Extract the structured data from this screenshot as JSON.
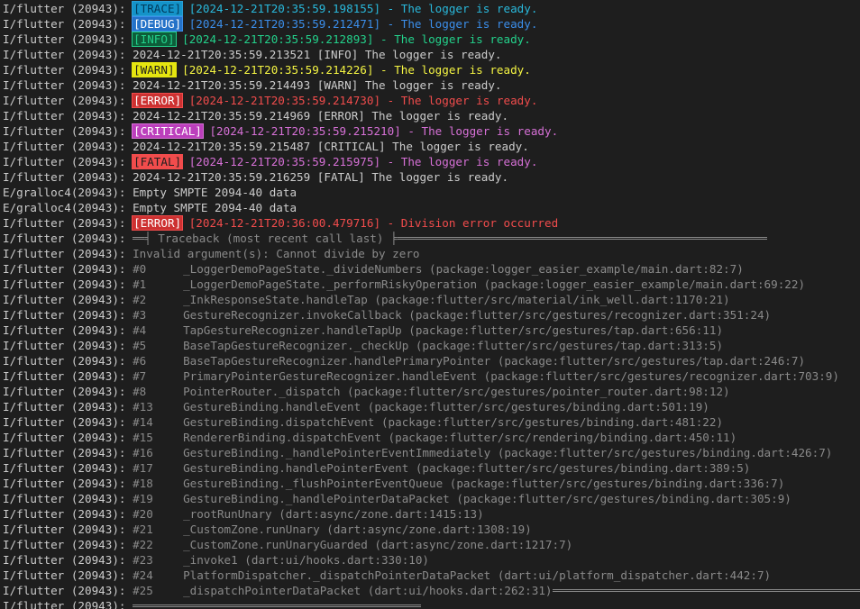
{
  "prefix_flutter": "I/flutter (20943): ",
  "prefix_gralloc": "E/gralloc4(20943): ",
  "intro_lines": [
    {
      "badge": "[TRACE]",
      "level": "trace",
      "text": " [2024-12-21T20:35:59.198155] - The logger is ready."
    },
    {
      "badge": "[DEBUG]",
      "level": "debug",
      "text": " [2024-12-21T20:35:59.212471] - The logger is ready."
    },
    {
      "badge": "[INFO]",
      "level": "info",
      "text": " [2024-12-21T20:35:59.212893] - The logger is ready."
    },
    {
      "plain": "2024-12-21T20:35:59.213521 [INFO] The logger is ready."
    },
    {
      "badge": "[WARN]",
      "level": "warn",
      "text": " [2024-12-21T20:35:59.214226] - The logger is ready."
    },
    {
      "plain": "2024-12-21T20:35:59.214493 [WARN] The logger is ready."
    },
    {
      "badge": "[ERROR]",
      "level": "error",
      "text": " [2024-12-21T20:35:59.214730] - The logger is ready."
    },
    {
      "plain": "2024-12-21T20:35:59.214969 [ERROR] The logger is ready."
    },
    {
      "badge": "[CRITICAL]",
      "level": "critical",
      "text": " [2024-12-21T20:35:59.215210] - The logger is ready."
    },
    {
      "plain": "2024-12-21T20:35:59.215487 [CRITICAL] The logger is ready."
    },
    {
      "badge": "[FATAL]",
      "level": "fatal",
      "text": " [2024-12-21T20:35:59.215975] - The logger is ready."
    },
    {
      "plain": "2024-12-21T20:35:59.216259 [FATAL] The logger is ready."
    },
    {
      "gralloc": "Empty SMPTE 2094-40 data"
    },
    {
      "gralloc": "Empty SMPTE 2094-40 data"
    },
    {
      "badge": "[ERROR]",
      "level": "error",
      "text": " [2024-12-21T20:36:00.479716] - Division error occurred"
    }
  ],
  "traceback_title": " Traceback (most recent call last) ",
  "error_message": "Invalid argument(s): Cannot divide by zero",
  "frames": [
    {
      "num": "#0",
      "frame": "_LoggerDemoPageState._divideNumbers (package:logger_easier_example/main.dart:82:7)"
    },
    {
      "num": "#1",
      "frame": "_LoggerDemoPageState._performRiskyOperation (package:logger_easier_example/main.dart:69:22)"
    },
    {
      "num": "#2",
      "frame": "_InkResponseState.handleTap (package:flutter/src/material/ink_well.dart:1170:21)"
    },
    {
      "num": "#3",
      "frame": "GestureRecognizer.invokeCallback (package:flutter/src/gestures/recognizer.dart:351:24)"
    },
    {
      "num": "#4",
      "frame": "TapGestureRecognizer.handleTapUp (package:flutter/src/gestures/tap.dart:656:11)"
    },
    {
      "num": "#5",
      "frame": "BaseTapGestureRecognizer._checkUp (package:flutter/src/gestures/tap.dart:313:5)"
    },
    {
      "num": "#6",
      "frame": "BaseTapGestureRecognizer.handlePrimaryPointer (package:flutter/src/gestures/tap.dart:246:7)"
    },
    {
      "num": "#7",
      "frame": "PrimaryPointerGestureRecognizer.handleEvent (package:flutter/src/gestures/recognizer.dart:703:9)"
    },
    {
      "num": "#8",
      "frame": "PointerRouter._dispatch (package:flutter/src/gestures/pointer_router.dart:98:12)"
    },
    {
      "num": "#13",
      "frame": "GestureBinding.handleEvent (package:flutter/src/gestures/binding.dart:501:19)"
    },
    {
      "num": "#14",
      "frame": "GestureBinding.dispatchEvent (package:flutter/src/gestures/binding.dart:481:22)"
    },
    {
      "num": "#15",
      "frame": "RendererBinding.dispatchEvent (package:flutter/src/rendering/binding.dart:450:11)"
    },
    {
      "num": "#16",
      "frame": "GestureBinding._handlePointerEventImmediately (package:flutter/src/gestures/binding.dart:426:7)"
    },
    {
      "num": "#17",
      "frame": "GestureBinding.handlePointerEvent (package:flutter/src/gestures/binding.dart:389:5)"
    },
    {
      "num": "#18",
      "frame": "GestureBinding._flushPointerEventQueue (package:flutter/src/gestures/binding.dart:336:7)"
    },
    {
      "num": "#19",
      "frame": "GestureBinding._handlePointerDataPacket (package:flutter/src/gestures/binding.dart:305:9)"
    },
    {
      "num": "#20",
      "frame": "_rootRunUnary (dart:async/zone.dart:1415:13)"
    },
    {
      "num": "#21",
      "frame": "_CustomZone.runUnary (dart:async/zone.dart:1308:19)"
    },
    {
      "num": "#22",
      "frame": "_CustomZone.runUnaryGuarded (dart:async/zone.dart:1217:7)"
    },
    {
      "num": "#23",
      "frame": "_invoke1 (dart:ui/hooks.dart:330:10)"
    },
    {
      "num": "#24",
      "frame": "PlatformDispatcher._dispatchPointerDataPacket (dart:ui/platform_dispatcher.dart:442:7)"
    },
    {
      "num": "#25",
      "frame": "_dispatchPointerDataPacket (dart:ui/hooks.dart:262:31)"
    }
  ],
  "colors": {
    "background": "#1e1e1e",
    "text": "#cccccc",
    "trace": "#29b8db",
    "debug": "#3b8eea",
    "info": "#23d18b",
    "warn": "#f5f543",
    "error": "#f14c4c",
    "critical": "#d670d6"
  }
}
